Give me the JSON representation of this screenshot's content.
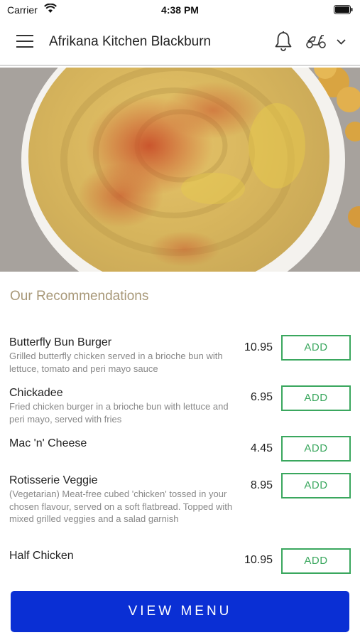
{
  "status_bar": {
    "carrier": "Carrier",
    "time": "4:38 PM"
  },
  "header": {
    "title": "Afrikana Kitchen Blackburn",
    "icons": [
      "menu-icon",
      "bell-icon",
      "scooter-icon",
      "chevron-down-icon"
    ]
  },
  "recommendations": {
    "title": "Our Recommendations",
    "add_label": "ADD",
    "items": [
      {
        "name": "Butterfly Bun Burger",
        "description": "Grilled butterfly chicken served in a brioche bun with lettuce, tomato and peri mayo sauce",
        "price": "10.95"
      },
      {
        "name": "Chickadee",
        "description": "Fried chicken burger in a brioche bun with lettuce and peri mayo, served with fries",
        "price": "6.95"
      },
      {
        "name": "Mac 'n' Cheese",
        "description": "",
        "price": "4.45"
      },
      {
        "name": "Rotisserie Veggie",
        "description": "(Vegetarian) Meat-free cubed 'chicken' tossed in your chosen flavour, served on a soft flatbread. Topped with mixed grilled veggies and a salad garnish",
        "price": "8.95"
      },
      {
        "name": "Half Chicken",
        "description": "",
        "price": "10.95"
      }
    ]
  },
  "footer": {
    "view_menu_label": "VIEW MENU"
  },
  "colors": {
    "accent_green": "#3aa75e",
    "primary_blue": "#0a2fd4",
    "section_title": "#a89878"
  }
}
